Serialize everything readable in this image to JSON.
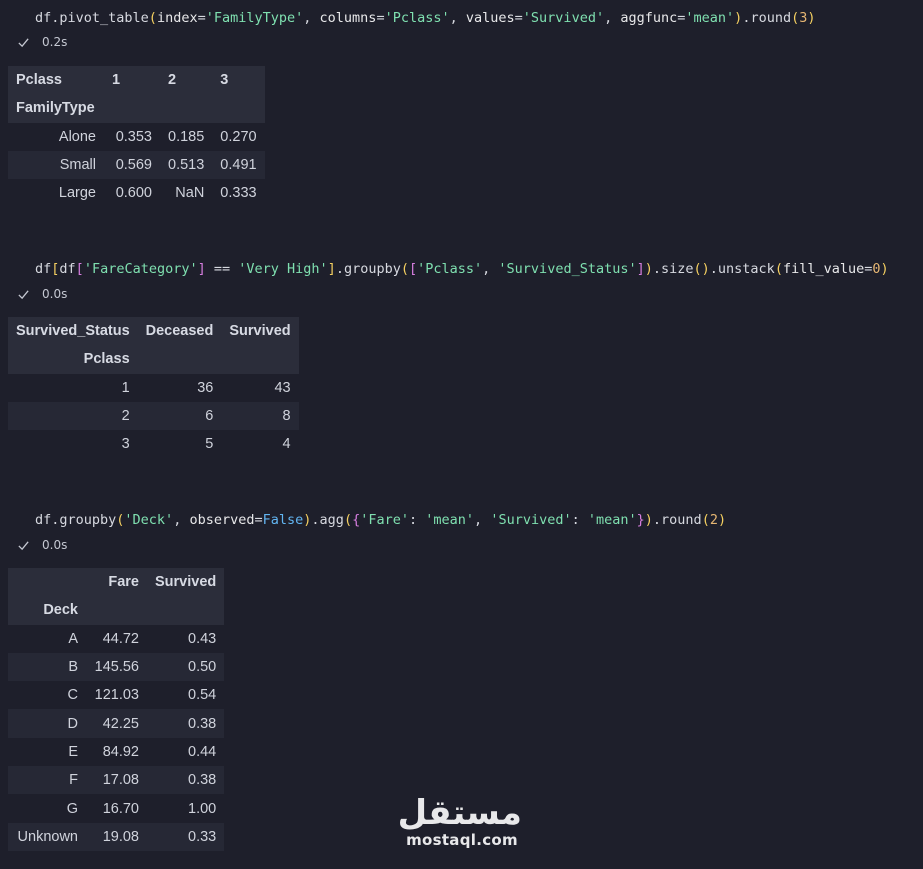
{
  "cells": [
    {
      "code": {
        "tokens": [
          [
            "fn",
            "df.pivot_table"
          ],
          [
            "br1",
            "("
          ],
          [
            "kw",
            "index"
          ],
          [
            "op",
            "="
          ],
          [
            "str",
            "'FamilyType'"
          ],
          [
            "op",
            ", "
          ],
          [
            "kw",
            "columns"
          ],
          [
            "op",
            "="
          ],
          [
            "str",
            "'Pclass'"
          ],
          [
            "op",
            ", "
          ],
          [
            "kw",
            "values"
          ],
          [
            "op",
            "="
          ],
          [
            "str",
            "'Survived'"
          ],
          [
            "op",
            ", "
          ],
          [
            "kw",
            "aggfunc"
          ],
          [
            "op",
            "="
          ],
          [
            "str",
            "'mean'"
          ],
          [
            "br1",
            ")"
          ],
          [
            "fn",
            ".round"
          ],
          [
            "br1",
            "("
          ],
          [
            "num",
            "3"
          ],
          [
            "br1",
            ")"
          ]
        ]
      },
      "status_time": "0.2s",
      "table": {
        "col_header_label": "Pclass",
        "columns": [
          "1",
          "2",
          "3"
        ],
        "index_name": "FamilyType",
        "rows": [
          {
            "index": "Alone",
            "values": [
              "0.353",
              "0.185",
              "0.270"
            ]
          },
          {
            "index": "Small",
            "values": [
              "0.569",
              "0.513",
              "0.491"
            ]
          },
          {
            "index": "Large",
            "values": [
              "0.600",
              "NaN",
              "0.333"
            ]
          }
        ]
      }
    },
    {
      "code": {
        "tokens": [
          [
            "fn",
            "df"
          ],
          [
            "br1",
            "["
          ],
          [
            "fn",
            "df"
          ],
          [
            "br2",
            "["
          ],
          [
            "str",
            "'FareCategory'"
          ],
          [
            "br2",
            "]"
          ],
          [
            "op",
            " == "
          ],
          [
            "str",
            "'Very High'"
          ],
          [
            "br1",
            "]"
          ],
          [
            "fn",
            ".groupby"
          ],
          [
            "br1",
            "("
          ],
          [
            "br2",
            "["
          ],
          [
            "str",
            "'Pclass'"
          ],
          [
            "op",
            ", "
          ],
          [
            "str",
            "'Survived_Status'"
          ],
          [
            "br2",
            "]"
          ],
          [
            "br1",
            ")"
          ],
          [
            "fn",
            ".size"
          ],
          [
            "br1",
            "()"
          ],
          [
            "fn",
            ".unstack"
          ],
          [
            "br1",
            "("
          ],
          [
            "kw",
            "fill_value"
          ],
          [
            "op",
            "="
          ],
          [
            "num",
            "0"
          ],
          [
            "br1",
            ")"
          ]
        ]
      },
      "status_time": "0.0s",
      "table": {
        "col_header_label": "Survived_Status",
        "columns": [
          "Deceased",
          "Survived"
        ],
        "index_name": "Pclass",
        "rows": [
          {
            "index": "1",
            "values": [
              "36",
              "43"
            ]
          },
          {
            "index": "2",
            "values": [
              "6",
              "8"
            ]
          },
          {
            "index": "3",
            "values": [
              "5",
              "4"
            ]
          }
        ]
      }
    },
    {
      "code": {
        "tokens": [
          [
            "fn",
            "df.groupby"
          ],
          [
            "br1",
            "("
          ],
          [
            "str",
            "'Deck'"
          ],
          [
            "op",
            ", "
          ],
          [
            "kw",
            "observed"
          ],
          [
            "op",
            "="
          ],
          [
            "bool",
            "False"
          ],
          [
            "br1",
            ")"
          ],
          [
            "fn",
            ".agg"
          ],
          [
            "br1",
            "("
          ],
          [
            "br2",
            "{"
          ],
          [
            "str",
            "'Fare'"
          ],
          [
            "op",
            ": "
          ],
          [
            "str",
            "'mean'"
          ],
          [
            "op",
            ", "
          ],
          [
            "str",
            "'Survived'"
          ],
          [
            "op",
            ": "
          ],
          [
            "str",
            "'mean'"
          ],
          [
            "br2",
            "}"
          ],
          [
            "br1",
            ")"
          ],
          [
            "fn",
            ".round"
          ],
          [
            "br1",
            "("
          ],
          [
            "num",
            "2"
          ],
          [
            "br1",
            ")"
          ]
        ]
      },
      "status_time": "0.0s",
      "table": {
        "col_header_label": "",
        "columns": [
          "Fare",
          "Survived"
        ],
        "index_name": "Deck",
        "rows": [
          {
            "index": "A",
            "values": [
              "44.72",
              "0.43"
            ]
          },
          {
            "index": "B",
            "values": [
              "145.56",
              "0.50"
            ]
          },
          {
            "index": "C",
            "values": [
              "121.03",
              "0.54"
            ]
          },
          {
            "index": "D",
            "values": [
              "42.25",
              "0.38"
            ]
          },
          {
            "index": "E",
            "values": [
              "84.92",
              "0.44"
            ]
          },
          {
            "index": "F",
            "values": [
              "17.08",
              "0.38"
            ]
          },
          {
            "index": "G",
            "values": [
              "16.70",
              "1.00"
            ]
          },
          {
            "index": "Unknown",
            "values": [
              "19.08",
              "0.33"
            ]
          }
        ]
      }
    }
  ],
  "watermark": {
    "arabic": "مستقل",
    "latin": "mostaql.com"
  },
  "colors": {
    "background": "#1e1f2b",
    "header_row": "#2b2d3a",
    "alt_row": "#262835",
    "string": "#7fe0b0",
    "number": "#e6b673",
    "bracket_outer": "#f5d061",
    "bracket_inner": "#d77ee0",
    "boolean": "#62b5f2"
  }
}
